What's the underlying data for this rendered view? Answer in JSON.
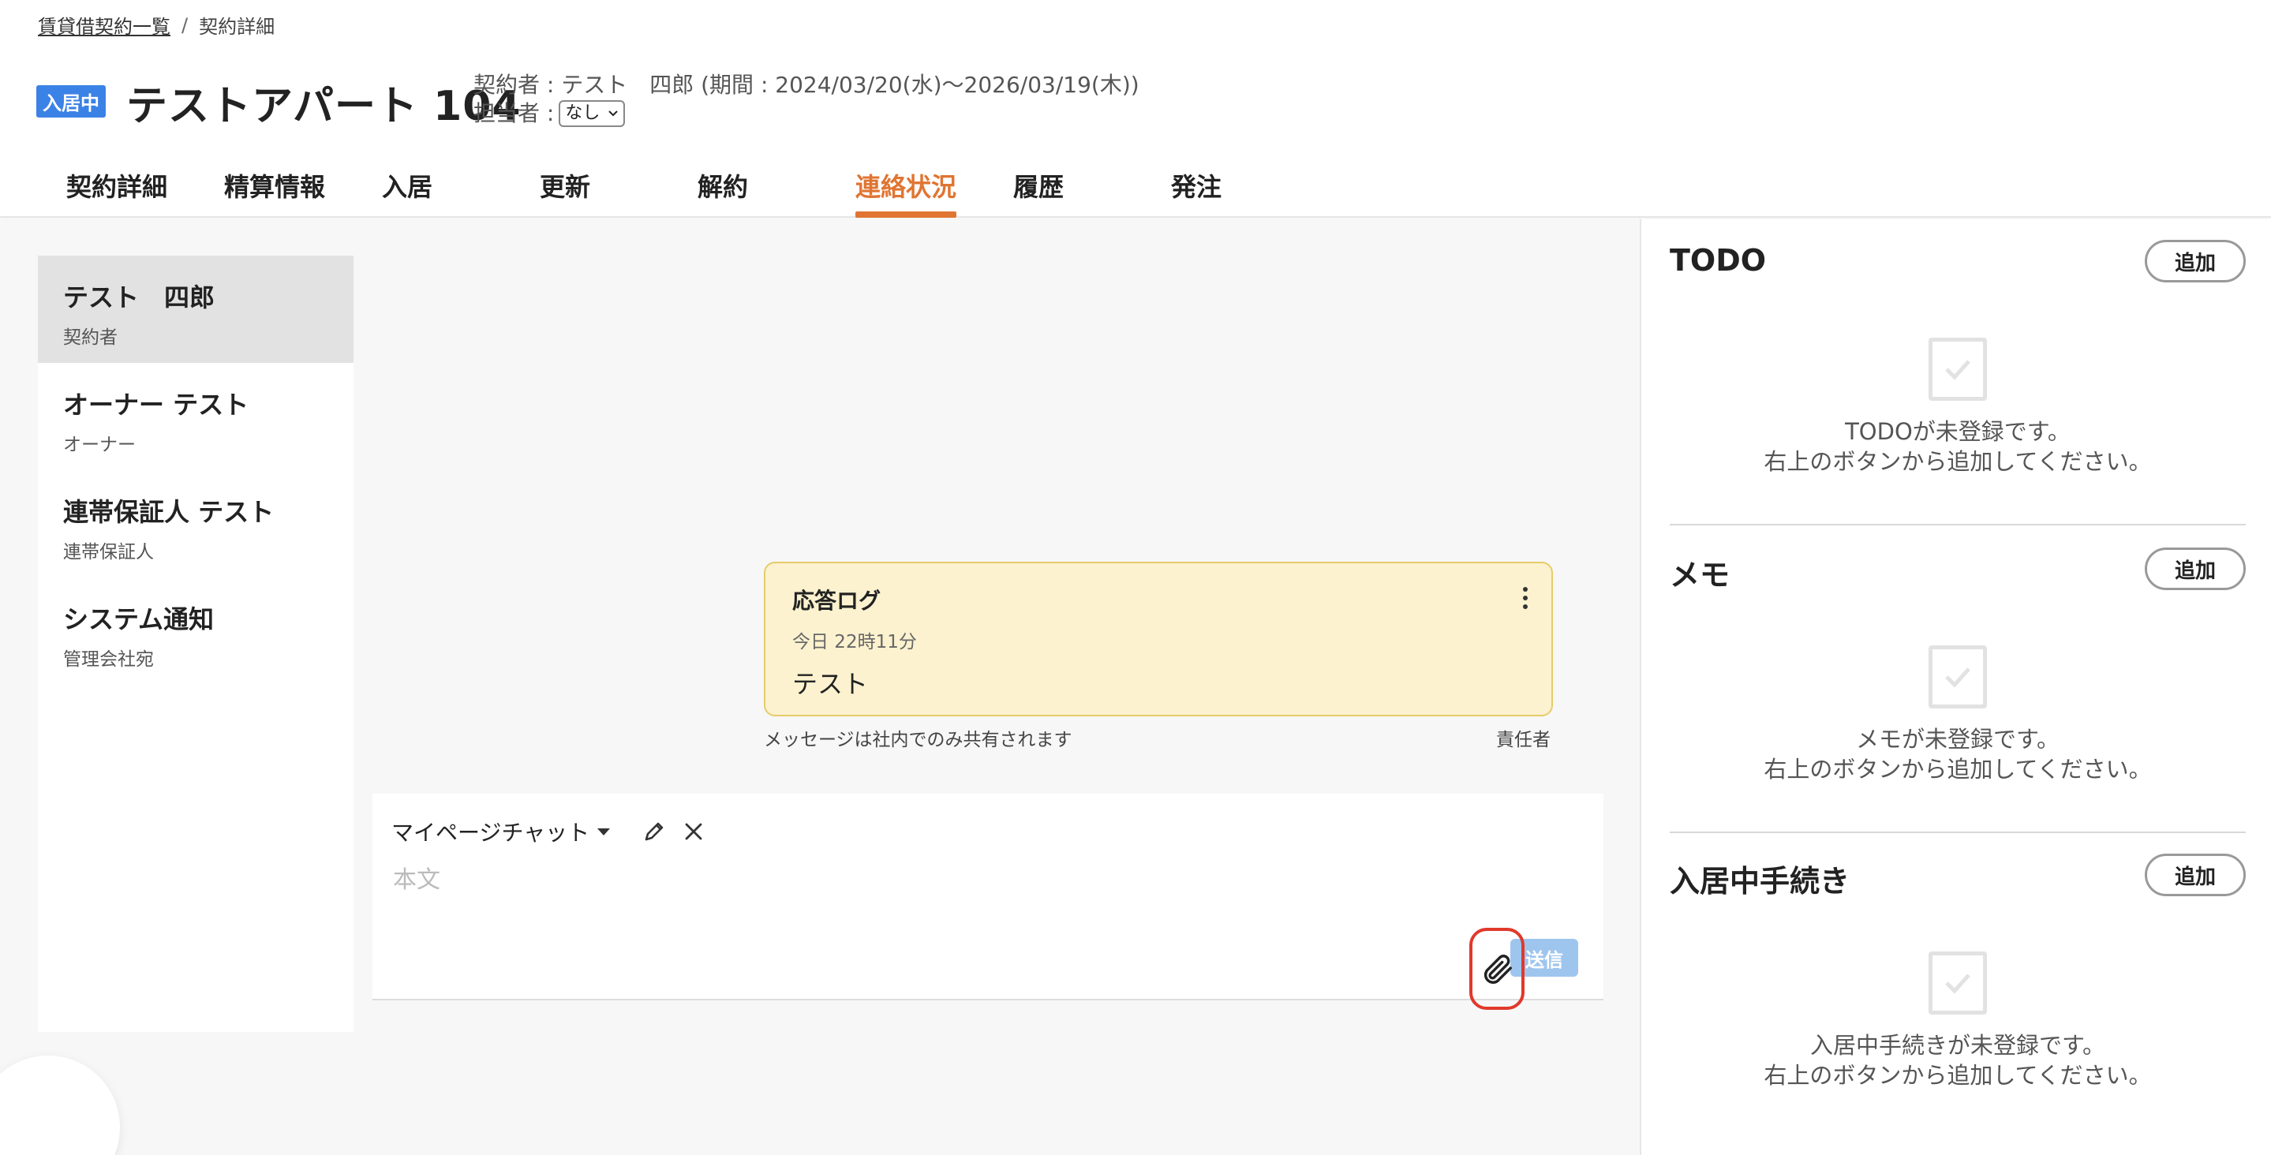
{
  "breadcrumb": {
    "list": "賃貸借契約一覧",
    "separator": "/",
    "current": "契約詳細"
  },
  "header": {
    "status_badge": "入居中",
    "title": "テストアパート 104",
    "contract_info": "契約者 : テスト　四郎 (期間 : 2024/03/20(水)〜2026/03/19(木))",
    "assignee_label": "担当者 :",
    "assignee_value": "なし"
  },
  "tabs": [
    {
      "label": "契約詳細"
    },
    {
      "label": "精算情報"
    },
    {
      "label": "入居"
    },
    {
      "label": "更新"
    },
    {
      "label": "解約"
    },
    {
      "label": "連絡状況"
    },
    {
      "label": "履歴"
    },
    {
      "label": "発注"
    }
  ],
  "active_tab": "連絡状況",
  "contacts": [
    {
      "name": "テスト　四郎",
      "role": "契約者"
    },
    {
      "name": "オーナー テスト",
      "role": "オーナー"
    },
    {
      "name": "連帯保証人 テスト",
      "role": "連帯保証人"
    },
    {
      "name": "システム通知",
      "role": "管理会社宛"
    }
  ],
  "message": {
    "title": "応答ログ",
    "time": "今日 22時11分",
    "body": "テスト",
    "note": "メッセージは社内でのみ共有されます",
    "owner": "責任者"
  },
  "composer": {
    "channel": "マイページチャット",
    "placeholder": "本文",
    "send_label": "送信"
  },
  "side": {
    "todo": {
      "title": "TODO",
      "add_label": "追加",
      "empty_line1": "TODOが未登録です。",
      "empty_line2": "右上のボタンから追加してください。"
    },
    "memo": {
      "title": "メモ",
      "add_label": "追加",
      "empty_line1": "メモが未登録です。",
      "empty_line2": "右上のボタンから追加してください。"
    },
    "procedure": {
      "title": "入居中手続き",
      "add_label": "追加",
      "empty_line1": "入居中手続きが未登録です。",
      "empty_line2": "右上のボタンから追加してください。"
    }
  },
  "icons": {
    "pencil": "pencil-icon",
    "close": "close-icon",
    "attach": "paperclip-icon",
    "kebab": "more-vertical-icon",
    "empty": "checkbox-icon"
  },
  "colors": {
    "accent": "#e07532",
    "badge": "#3b82e6",
    "message_bg": "#fcf2cf",
    "highlight": "#e0392b",
    "send": "#9ec5ee"
  }
}
